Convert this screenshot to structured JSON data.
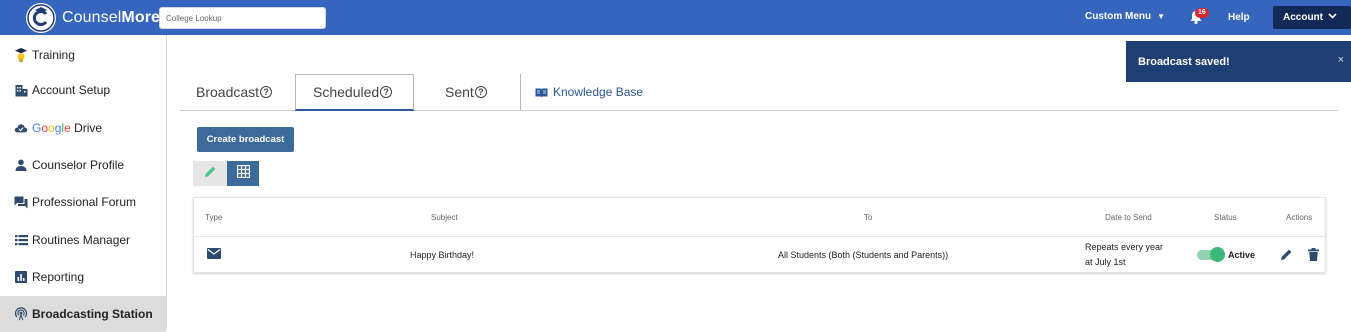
{
  "brand": {
    "name_regular": "Counsel",
    "name_bold": "More"
  },
  "header": {
    "search_placeholder": "College Lookup",
    "custom_menu": "Custom Menu",
    "notification_count": "16",
    "help": "Help",
    "account": "Account",
    "colors": {
      "bar": "#3565bd",
      "account_bg": "#132a58",
      "badge": "#d9262e"
    }
  },
  "sidebar": {
    "items": [
      {
        "label": "Training",
        "icon": "mortarboard-bulb-icon"
      },
      {
        "label": "Account Setup",
        "icon": "building-icon"
      },
      {
        "label_parts": [
          "G",
          "o",
          "o",
          "g",
          "l",
          "e"
        ],
        "label_suffix": " Drive",
        "icon": "cloud-check-icon"
      },
      {
        "label": "Counselor Profile",
        "icon": "person-icon"
      },
      {
        "label": "Professional Forum",
        "icon": "forum-icon"
      },
      {
        "label": "Routines Manager",
        "icon": "list-icon"
      },
      {
        "label": "Reporting",
        "icon": "bar-chart-icon"
      },
      {
        "label": "Broadcasting Station",
        "icon": "broadcast-icon",
        "active": true
      }
    ]
  },
  "tabs": {
    "broadcast": "Broadcast",
    "scheduled": "Scheduled",
    "sent": "Sent",
    "help_glyph": "?",
    "knowledge_base": "Knowledge Base",
    "active": "Scheduled"
  },
  "actions": {
    "create_broadcast": "Create broadcast"
  },
  "table": {
    "headers": [
      "Type",
      "Subject",
      "To",
      "Date to Send",
      "Status",
      "Actions"
    ],
    "rows": [
      {
        "type_icon": "envelope-icon",
        "subject": "Happy Birthday!",
        "to": "All Students (Both (Students and Parents))",
        "date_line1": "Repeats every year",
        "date_line2": "at July 1st",
        "status": "Active"
      }
    ]
  },
  "toast": {
    "message": "Broadcast saved!",
    "close": "×",
    "color": "#1f3f74"
  }
}
